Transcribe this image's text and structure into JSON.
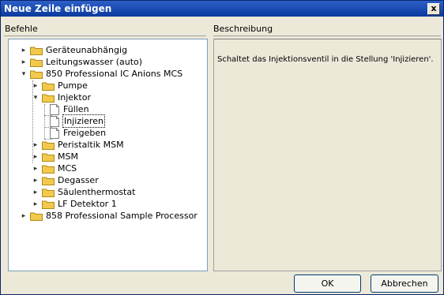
{
  "window": {
    "title": "Neue Zeile einfügen",
    "close_glyph": "x"
  },
  "columns": {
    "commands": "Befehle",
    "description": "Beschreibung"
  },
  "tree": [
    {
      "label": "Geräteunabhängig",
      "type": "folder",
      "expander": "+"
    },
    {
      "label": "Leitungswasser (auto)",
      "type": "folder",
      "expander": "+"
    },
    {
      "label": "850 Professional IC Anions MCS",
      "type": "folder",
      "expander": "-"
    },
    {
      "label": "Pumpe",
      "type": "folder",
      "expander": "+"
    },
    {
      "label": "Injektor",
      "type": "folder",
      "expander": "-"
    },
    {
      "label": "Füllen",
      "type": "document",
      "expander": ""
    },
    {
      "label": "Injizieren",
      "type": "document",
      "expander": "",
      "selected": true
    },
    {
      "label": "Freigeben",
      "type": "document",
      "expander": ""
    },
    {
      "label": "Peristaltik MSM",
      "type": "folder",
      "expander": "+"
    },
    {
      "label": "MSM",
      "type": "folder",
      "expander": "+"
    },
    {
      "label": "MCS",
      "type": "folder",
      "expander": "+"
    },
    {
      "label": "Degasser",
      "type": "folder",
      "expander": "+"
    },
    {
      "label": "Säulenthermostat",
      "type": "folder",
      "expander": "+"
    },
    {
      "label": "LF Detektor 1",
      "type": "folder",
      "expander": "+"
    },
    {
      "label": "858 Professional Sample Processor",
      "type": "folder",
      "expander": "+"
    }
  ],
  "description": {
    "text": "Schaltet das Injektionsventil in die Stellung 'Injizieren'."
  },
  "buttons": {
    "ok": "OK",
    "cancel": "Abbrechen"
  },
  "colors": {
    "titlebar": "#0a3a9c",
    "folder": "#f2c94c",
    "selection_border": "#000000"
  }
}
